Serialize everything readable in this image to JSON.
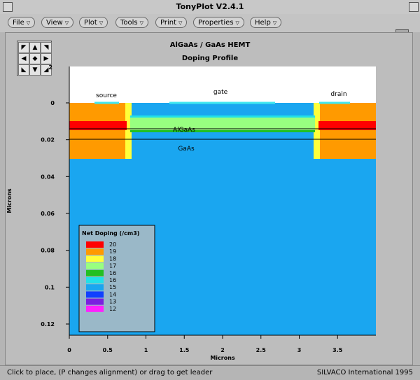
{
  "window": {
    "title": "TonyPlot V2.4.1"
  },
  "menus": [
    "File",
    "View",
    "Plot",
    "Tools",
    "Print",
    "Properties",
    "Help"
  ],
  "plot": {
    "title": "AlGaAs / GaAs HEMT",
    "subtitle": "Doping Profile",
    "xlabel": "Microns",
    "ylabel": "Microns",
    "xticks": [
      "0",
      "0.5",
      "1",
      "1.5",
      "2",
      "2.5",
      "3",
      "3.5"
    ],
    "yticks": [
      "0",
      "0.02",
      "0.04",
      "0.06",
      "0.08",
      "0.1",
      "0.12"
    ],
    "ytick_top": "2",
    "regions": {
      "source": "source",
      "gate": "gate",
      "drain": "drain",
      "algaas": "AlGaAs",
      "gaas": "GaAs"
    },
    "colors": {
      "c20": "#ff0000",
      "c19": "#ff9a00",
      "c18": "#ffff3a",
      "c17": "#98ff80",
      "c16_green": "#22c022",
      "c16": "#22e0e8",
      "c15": "#1aa6f0",
      "c14": "#1040ff",
      "c13": "#7a20e0",
      "c12": "#ff20ff"
    }
  },
  "legend": {
    "title": "Net Doping (/cm3)",
    "items": [
      {
        "label": "20",
        "color": "#ff0000"
      },
      {
        "label": "19",
        "color": "#ff9a00"
      },
      {
        "label": "18",
        "color": "#ffff3a"
      },
      {
        "label": "17",
        "color": "#98ff80"
      },
      {
        "label": "16",
        "color": "#22c022"
      },
      {
        "label": "16",
        "color": "#22e0e8"
      },
      {
        "label": "15",
        "color": "#1aa6f0"
      },
      {
        "label": "14",
        "color": "#1040ff"
      },
      {
        "label": "13",
        "color": "#7a20e0"
      },
      {
        "label": "12",
        "color": "#ff20ff"
      }
    ]
  },
  "status": {
    "left": "Click to place, (P changes alignment) or drag to get leader",
    "right": "SILVACO International 1995"
  },
  "nav": {
    "icon_names": [
      "arrow-nw",
      "arrow-n",
      "arrow-ne",
      "arrow-w",
      "center",
      "arrow-e",
      "arrow-sw",
      "arrow-s",
      "arrow-se"
    ]
  }
}
